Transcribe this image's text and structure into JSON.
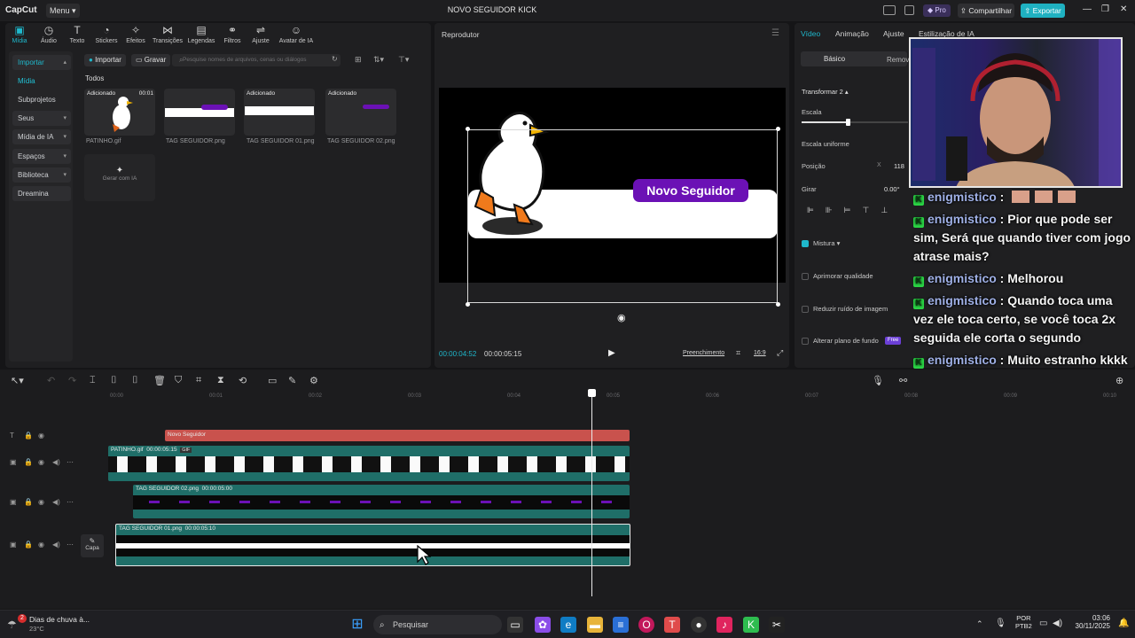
{
  "app": {
    "logo": "CapCut",
    "menu_label": "Menu",
    "window_title": "NOVO SEGUIDOR KICK",
    "pro_label": "Pro",
    "share_label": "Compartilhar",
    "export_label": "Exportar"
  },
  "tool_tabs": [
    "Mídia",
    "Áudio",
    "Texto",
    "Stickers",
    "Efeitos",
    "Transições",
    "Legendas",
    "Filtros",
    "Ajuste",
    "Avatar de IA"
  ],
  "side_nav": {
    "import": "Importar",
    "media": "Mídia",
    "subprojects": "Subprojetos",
    "yours": "Seus",
    "ai_media": "Mídia de IA",
    "spaces": "Espaços",
    "library": "Biblioteca",
    "dreamina": "Dreamina"
  },
  "media_toolbar": {
    "import": "Importar",
    "record": "Gravar",
    "search_placeholder": "Pesquise nomes de arquivos, cenas ou diálogos",
    "all_label": "Todos",
    "added_tag": "Adicionado"
  },
  "media_items": [
    {
      "name": "PATINHO.gif",
      "duration": "00:01"
    },
    {
      "name": "TAG SEGUIDOR.png"
    },
    {
      "name": "TAG SEGUIDOR 01.png"
    },
    {
      "name": "TAG SEGUIDOR 02.png"
    }
  ],
  "generate_ai": "Gerar com IA",
  "player": {
    "title": "Reprodutor",
    "sticker_text": "Novo Seguidor",
    "time_current": "00:00:04:52",
    "time_total": "00:00:05:15",
    "fill_label": "Preenchimento",
    "ratio_label": "16:9"
  },
  "inspector": {
    "tabs": [
      "Vídeo",
      "Animação",
      "Ajuste",
      "Estilização de IA"
    ],
    "subtabs": [
      "Básico",
      "Remov"
    ],
    "transform_label": "Transformar 2",
    "scale_label": "Escala",
    "uniform_scale_label": "Escala uniforme",
    "position_label": "Posição",
    "position_axis": "X",
    "position_x": "118",
    "rotate_label": "Girar",
    "rotate_value": "0.00°",
    "blend_label": "Mistura",
    "enhance_label": "Aprimorar qualidade",
    "denoise_label": "Reduzir ruído de imagem",
    "bg_label": "Alterar plano de fundo",
    "free_badge": "Free"
  },
  "chat": [
    {
      "user": "enigmistico",
      "text": ""
    },
    {
      "user": "enigmistico",
      "text": "Pior que pode ser sim, Será que quando tiver com jogo atrase mais?"
    },
    {
      "user": "enigmistico",
      "text": "Melhorou"
    },
    {
      "user": "enigmistico",
      "text": "Quando toca uma vez ele toca certo, se você toca 2x seguida ele corta o segundo"
    },
    {
      "user": "enigmistico",
      "text": "Muito estranho kkkk Mas agora tá bom assim"
    }
  ],
  "timeline": {
    "ruler": [
      "00:00",
      "00:01",
      "00:02",
      "00:03",
      "00:04",
      "00:05",
      "00:06",
      "00:07",
      "00:08",
      "00:09",
      "00:10"
    ],
    "text_clip": "Novo Seguidor",
    "clip_patinho": {
      "name": "PATINHO.gif",
      "duration": "00:00:05:15",
      "badge": "GIF"
    },
    "clip_tag02": {
      "name": "TAG SEGUIDOR 02.png",
      "duration": "00:00:05:00"
    },
    "clip_tag01": {
      "name": "TAG SEGUIDOR 01.png",
      "duration": "00:00:05:10"
    },
    "cover_label": "Capa"
  },
  "taskbar": {
    "weather_title": "Dias de chuva à...",
    "weather_temp": "23°C",
    "weather_badge": "2",
    "search_label": "Pesquisar",
    "lang_top": "POR",
    "lang_bottom": "PTB2",
    "time": "03:06",
    "date": "30/11/2025"
  },
  "colors": {
    "accent": "#1fb8cc",
    "text_clip": "#c9524d",
    "media_clip": "#1f6e68",
    "purple_tag": "#6b11b5"
  }
}
